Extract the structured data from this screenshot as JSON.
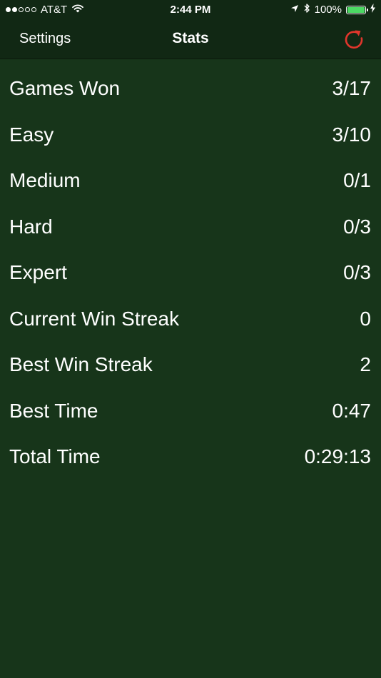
{
  "status_bar": {
    "carrier": "AT&T",
    "time": "2:44 PM",
    "battery_percent": "100%",
    "battery_level": 1.0,
    "signal_strength": 2,
    "signal_max": 5,
    "icons": [
      "wifi-icon",
      "location-arrow-icon",
      "bluetooth-icon",
      "battery-icon",
      "charging-bolt-icon"
    ]
  },
  "nav": {
    "settings_label": "Settings",
    "title": "Stats",
    "reset_icon": "refresh-icon",
    "accent_color": "#e0362c"
  },
  "colors": {
    "background": "#17351a",
    "bar_background": "#112814",
    "text": "#ffffff",
    "battery_fill": "#4cd964"
  },
  "stats": [
    {
      "label": "Games Won",
      "value": "3/17"
    },
    {
      "label": "Easy",
      "value": "3/10"
    },
    {
      "label": "Medium",
      "value": "0/1"
    },
    {
      "label": "Hard",
      "value": "0/3"
    },
    {
      "label": "Expert",
      "value": "0/3"
    },
    {
      "label": "Current Win Streak",
      "value": "0"
    },
    {
      "label": "Best Win Streak",
      "value": "2"
    },
    {
      "label": "Best Time",
      "value": "0:47"
    },
    {
      "label": "Total Time",
      "value": "0:29:13"
    }
  ]
}
